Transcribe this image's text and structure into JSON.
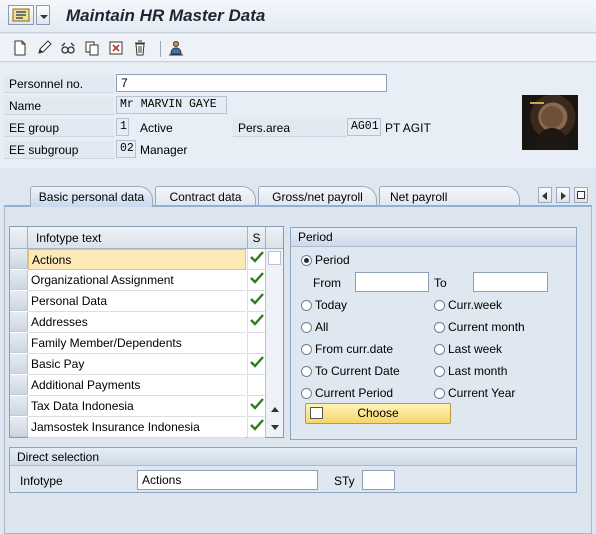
{
  "window": {
    "title": "Maintain HR Master Data"
  },
  "toolbar": {
    "icons": [
      "create-icon",
      "change-icon",
      "display-icon",
      "copy-icon",
      "delimit-icon",
      "delete-icon",
      "org-structure-icon"
    ]
  },
  "header": {
    "personnel_no": {
      "label": "Personnel no.",
      "value": "7"
    },
    "name": {
      "label": "Name",
      "value": "Mr MARVIN GAYE"
    },
    "ee_group": {
      "label": "EE group",
      "code": "1",
      "text": "Active"
    },
    "pers_area": {
      "label": "Pers.area",
      "code": "AG01",
      "text": "PT AGIT"
    },
    "ee_subgroup": {
      "label": "EE subgroup",
      "code": "02",
      "text": "Manager"
    }
  },
  "tabs": [
    {
      "label": "Basic personal data",
      "active": true
    },
    {
      "label": "Contract data",
      "active": false
    },
    {
      "label": "Gross/net payroll",
      "active": false
    },
    {
      "label": "Net payroll",
      "active": false
    }
  ],
  "infotypes": {
    "header_text": "Infotype text",
    "header_status": "S",
    "rows": [
      {
        "text": "Actions",
        "status": true,
        "selected": true
      },
      {
        "text": "Organizational Assignment",
        "status": true,
        "selected": false
      },
      {
        "text": "Personal Data",
        "status": true,
        "selected": false
      },
      {
        "text": "Addresses",
        "status": true,
        "selected": false
      },
      {
        "text": "Family Member/Dependents",
        "status": false,
        "selected": false
      },
      {
        "text": "Basic Pay",
        "status": true,
        "selected": false
      },
      {
        "text": "Additional Payments",
        "status": false,
        "selected": false
      },
      {
        "text": "Tax Data Indonesia",
        "status": true,
        "selected": false
      },
      {
        "text": "Jamsostek Insurance Indonesia",
        "status": true,
        "selected": false
      }
    ]
  },
  "period": {
    "title": "Period",
    "period_option": "Period",
    "from_label": "From",
    "to_label": "To",
    "from_value": "",
    "to_value": "",
    "options_left": [
      "Today",
      "All",
      "From curr.date",
      "To Current Date",
      "Current Period"
    ],
    "options_right": [
      "Curr.week",
      "Current month",
      "Last week",
      "Last month",
      "Current Year"
    ],
    "selected": "Period",
    "choose_label": "Choose"
  },
  "direct_selection": {
    "title": "Direct selection",
    "infotype_label": "Infotype",
    "infotype_value": "Actions",
    "sty_label": "STy",
    "sty_value": ""
  }
}
